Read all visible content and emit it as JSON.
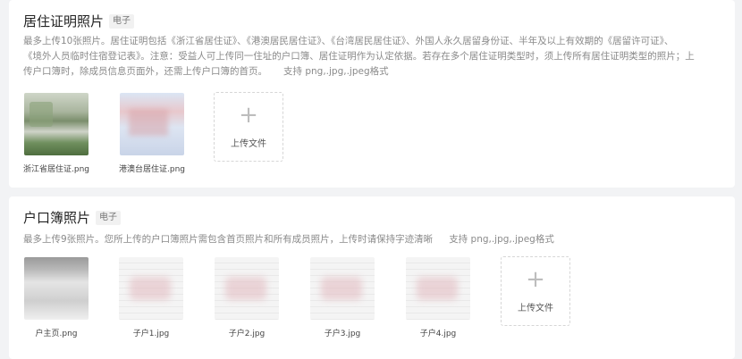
{
  "sections": [
    {
      "title": "居住证明照片",
      "tag": "电子",
      "desc_lines": [
        "最多上传10张照片。居住证明包括《浙江省居住证》、《港澳居民居住证》、《台湾居民居住证》、外国人永久居留身份证、半年及以上有效期的《居留许可证》、",
        "《境外人员临时住宿登记表》。注意：受益人可上传同一住址的户口簿、居住证明作为认定依据。若存在多个居住证明类型时，须上传所有居住证明类型的照片；上",
        "传户口簿时，除成员信息页面外，还需上传户口簿的首页。"
      ],
      "format": "支持 png,.jpg,.jpeg格式",
      "files": [
        {
          "name": "浙江省居住证.png",
          "style": "ph-green"
        },
        {
          "name": "港澳台居住证.png",
          "style": "ph-blue"
        }
      ],
      "upload_label": "上传文件",
      "upload_plus": "+"
    },
    {
      "title": "户口簿照片",
      "tag": "电子",
      "desc": "最多上传9张照片。您所上传的户口簿照片需包含首页照片和所有成员照片，上传时请保持字迹清晰",
      "format": "支持 png,.jpg,.jpeg格式",
      "files": [
        {
          "name": "户主页.png",
          "style": "ph-book-dark"
        },
        {
          "name": "子户1.jpg",
          "style": "ph-book"
        },
        {
          "name": "子户2.jpg",
          "style": "ph-book"
        },
        {
          "name": "子户3.jpg",
          "style": "ph-book"
        },
        {
          "name": "子户4.jpg",
          "style": "ph-book"
        }
      ],
      "upload_label": "上传文件",
      "upload_plus": "+"
    }
  ]
}
